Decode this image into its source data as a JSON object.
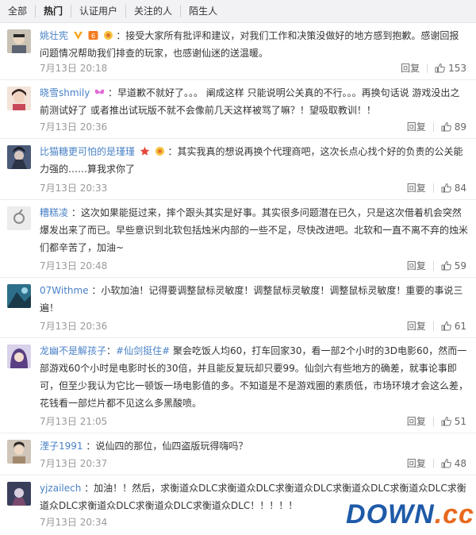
{
  "tabs": [
    "全部",
    "热门",
    "认证用户",
    "关注的人",
    "陌生人"
  ],
  "active_tab": "热门",
  "reply_label": "回复",
  "comments": [
    {
      "name": "姚壮宪",
      "text": "：接受大家所有批评和建议，对我们工作和决策没做好的地方感到抱歉。感谢回报问题情况帮助我们排查的玩家，也感谢仙迷的送温暖。",
      "time": "7月13日 20:18",
      "likes": "153"
    },
    {
      "name": "晓雪shmily",
      "text": "：早道歉不就好了。。。 阐成这样 只能说明公关真的不行。。。再换句话说 游戏没出之前测试好了 或者推出试玩版不就不会像前几天这样被骂了嘛？！望吸取教训！！",
      "time": "7月13日 20:36",
      "likes": "89"
    },
    {
      "name": "比猫糖更可怕的是瑾瑾",
      "text": "：其实我真的想说再换个代理商吧，这次长点心找个好的负责的公关能力强的……算我求你了",
      "time": "7月13日 20:33",
      "likes": "84"
    },
    {
      "name": "糟糕凌",
      "text": "：这次如果能挺过来，摔个跟头其实是好事。其实很多问题潜在已久，只是这次借着机会突然爆发出来了而已。早些意识到北软包括烛米内部的一些不足，尽快改进吧。北软和一直不离不弃的烛米们都辛苦了，加油~",
      "time": "7月13日 20:48",
      "likes": "59"
    },
    {
      "name": "07Withme",
      "text": "：小软加油！记得要调整鼠标灵敏度！调整鼠标灵敏度！调整鼠标灵敏度！重要的事说三遍！",
      "time": "7月13日 20:36",
      "likes": "61"
    },
    {
      "name": "龙幽不是解孩子",
      "tag": "#仙剑挺住#",
      "text": "聚会吃饭人均60，打车回家30，看一部2个小时的3D电影60，然而一部游戏60个小时是电影时长的30倍，并且能反复玩却只要99。仙剑六有些地方的确差，就事论事即可，但至少我认为它比一顿饭一场电影值的多。不知道是不是游戏圈的素质低，市场环境才会这么差，花钱看一部烂片都不见这么多黑酸喷。",
      "time": "7月13日 21:05",
      "likes": "51"
    },
    {
      "name": "湮子1991",
      "text": "：说仙四的那位，仙四盗版玩得嗨吗？",
      "time": "7月13日 20:37",
      "likes": "48"
    },
    {
      "name": "yjzailech",
      "text": "：加油！！然后，求衡道众DLC求衡道众DLC求衡道众DLC求衡道众DLC求衡道众DLC求衡道众DLC求衡道众DLC求衡道众DLC求衡道众DLC！！！！！",
      "time": "7月13日 20:34",
      "likes": ""
    }
  ],
  "watermark": {
    "part1": "DOWN",
    "part2": ".cc"
  },
  "colors": {
    "link": "#4a82c7",
    "muted": "#999999",
    "tabs_bg": "#f2f2f5"
  }
}
